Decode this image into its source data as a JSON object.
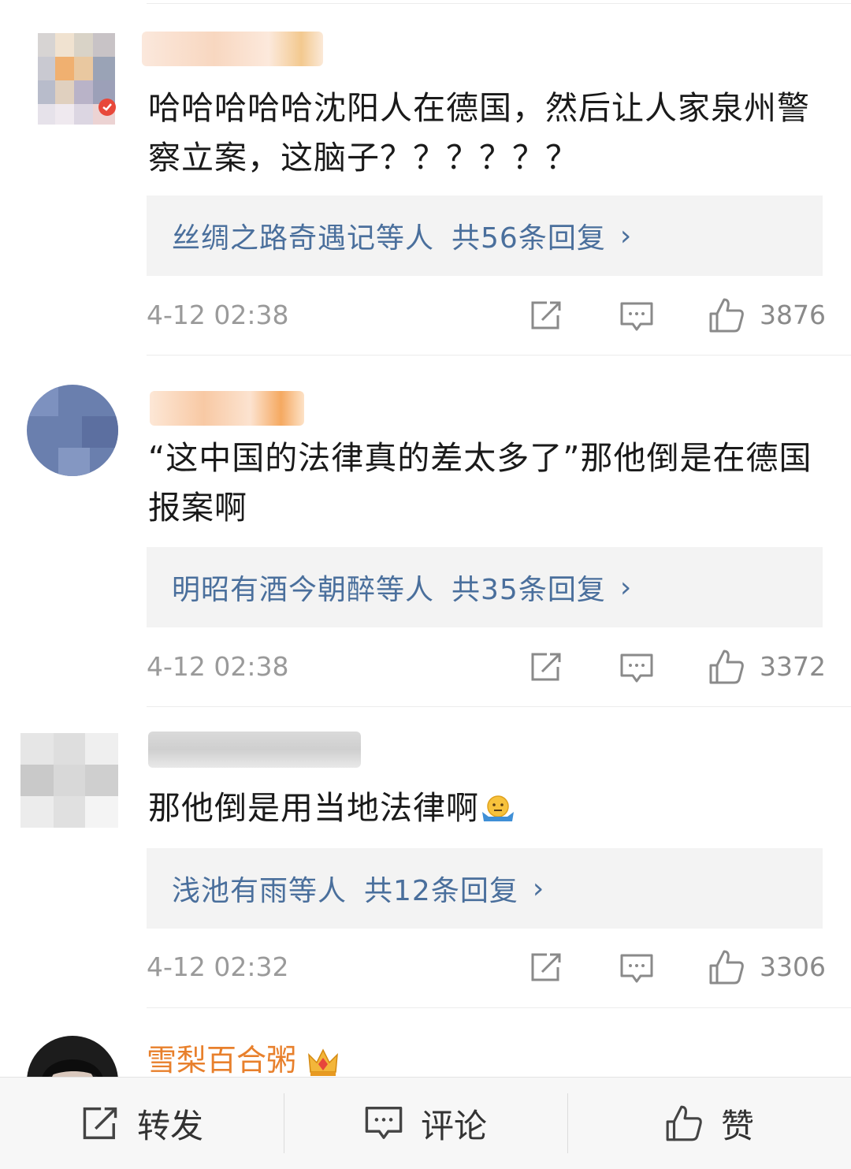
{
  "comments": [
    {
      "text": "哈哈哈哈哈沈阳人在德国，然后让人家泉州警察立案，这脑子？？？？？？",
      "reply_names": "丝绸之路奇遇记",
      "reply_etc": "等人",
      "reply_count": "共56条回复",
      "reply_chevron": "›",
      "time": "4-12 02:38",
      "likes": "3876"
    },
    {
      "text": "“这中国的法律真的差太多了”那他倒是在德国报案啊",
      "reply_names": "明昭有酒今朝醉",
      "reply_etc": "等人",
      "reply_count": "共35条回复",
      "reply_chevron": "›",
      "time": "4-12 02:38",
      "likes": "3372"
    },
    {
      "text": "那他倒是用当地法律啊",
      "reply_names": "浅池有雨",
      "reply_etc": "等人",
      "reply_count": "共12条回复",
      "reply_chevron": "›",
      "time": "4-12 02:32",
      "likes": "3306"
    }
  ],
  "last_comment": {
    "username": "雪梨百合粥"
  },
  "bottom_bar": {
    "repost_label": "转发",
    "comment_label": "评论",
    "like_label": "赞"
  },
  "colors": {
    "username": "#e8802c",
    "link": "#4a6f9c",
    "meta": "#9a9a9a",
    "reply_bg": "#f3f3f3"
  },
  "icons": [
    "share-icon",
    "comment-icon",
    "like-icon",
    "shrug-emoji-icon",
    "crown-badge-icon",
    "verified-badge-icon"
  ]
}
